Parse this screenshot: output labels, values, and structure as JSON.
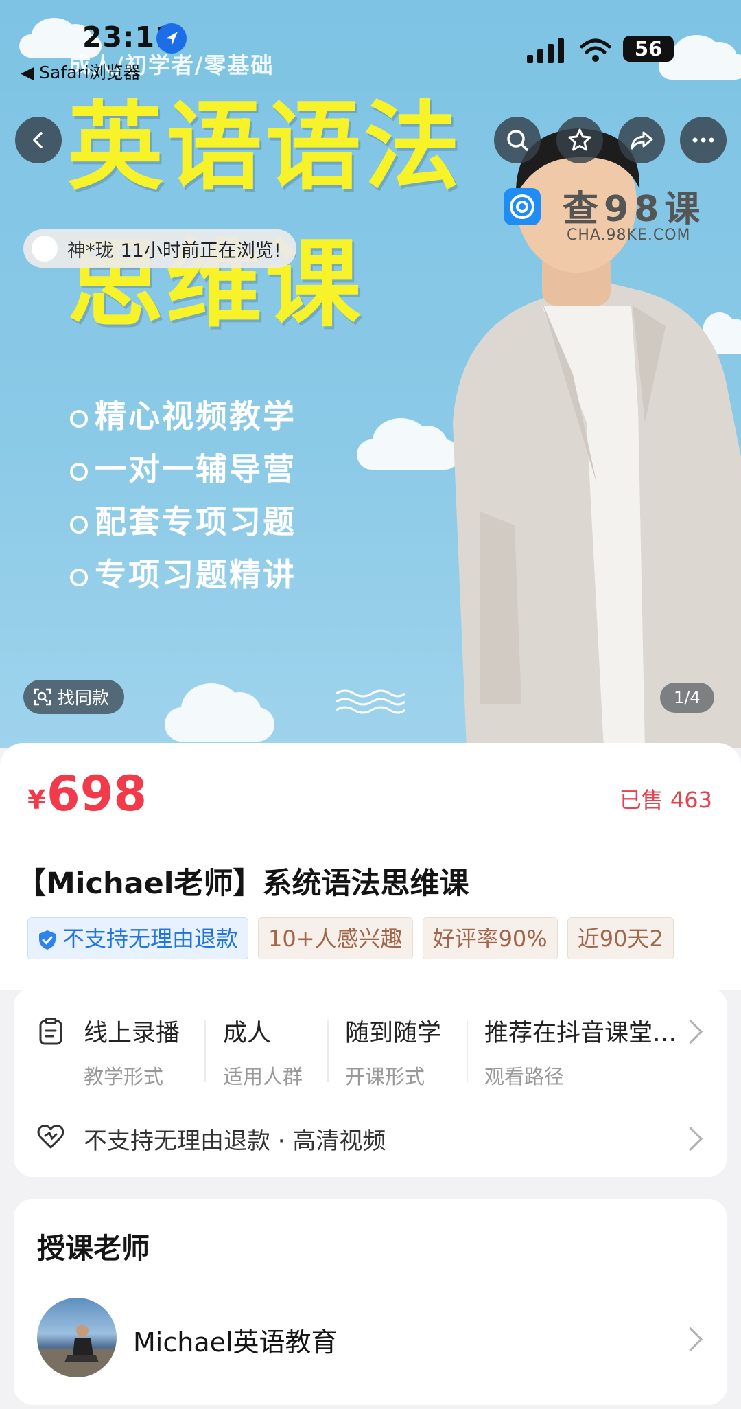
{
  "status_bar": {
    "time": "23:11",
    "back_app": "◀ Safari浏览器",
    "battery": "56"
  },
  "hero": {
    "subtitle": "成人/初学者/零基础",
    "title_line1": "英语语法",
    "title_line2": "思维课",
    "features": [
      "精心视频教学",
      "一对一辅导营",
      "配套专项习题",
      "专项习题精讲"
    ],
    "watermark_text": "查98课",
    "watermark_url": "CHA.98KE.COM",
    "browse_user": "神*珑",
    "browse_text": "11小时前正在浏览!",
    "find_similar": "找同款",
    "page_indicator": "1/4"
  },
  "product": {
    "currency": "¥",
    "price": "698",
    "sold": "已售 463",
    "title": "【Michael老师】系统语法思维课",
    "tags": [
      {
        "label": "不支持无理由退款",
        "style": "blue"
      },
      {
        "label": "10+人感兴趣",
        "style": "beige"
      },
      {
        "label": "好评率90%",
        "style": "beige"
      },
      {
        "label": "近90天2",
        "style": "beige"
      }
    ]
  },
  "info": {
    "items": [
      {
        "value": "线上录播",
        "key": "教学形式"
      },
      {
        "value": "成人",
        "key": "适用人群"
      },
      {
        "value": "随到随学",
        "key": "开课形式"
      },
      {
        "value": "推荐在抖音课堂…",
        "key": "观看路径"
      }
    ],
    "refund_row": "不支持无理由退款 · 高清视频"
  },
  "teacher": {
    "heading": "授课老师",
    "name": "Michael英语教育"
  },
  "colors": {
    "price_red": "#f23a4b",
    "hero_sky": "#8bcae7",
    "title_yellow": "#f7f328",
    "tag_blue": "#2274e0",
    "tag_beige": "#a2664a"
  },
  "icons": [
    "back-arrow-icon",
    "search-icon",
    "star-icon",
    "share-icon",
    "more-icon",
    "shield-check-icon",
    "clipboard-icon",
    "heart-icon",
    "chevron-right-icon",
    "scan-icon",
    "location-arrow-icon",
    "signal-icon",
    "wifi-icon"
  ]
}
